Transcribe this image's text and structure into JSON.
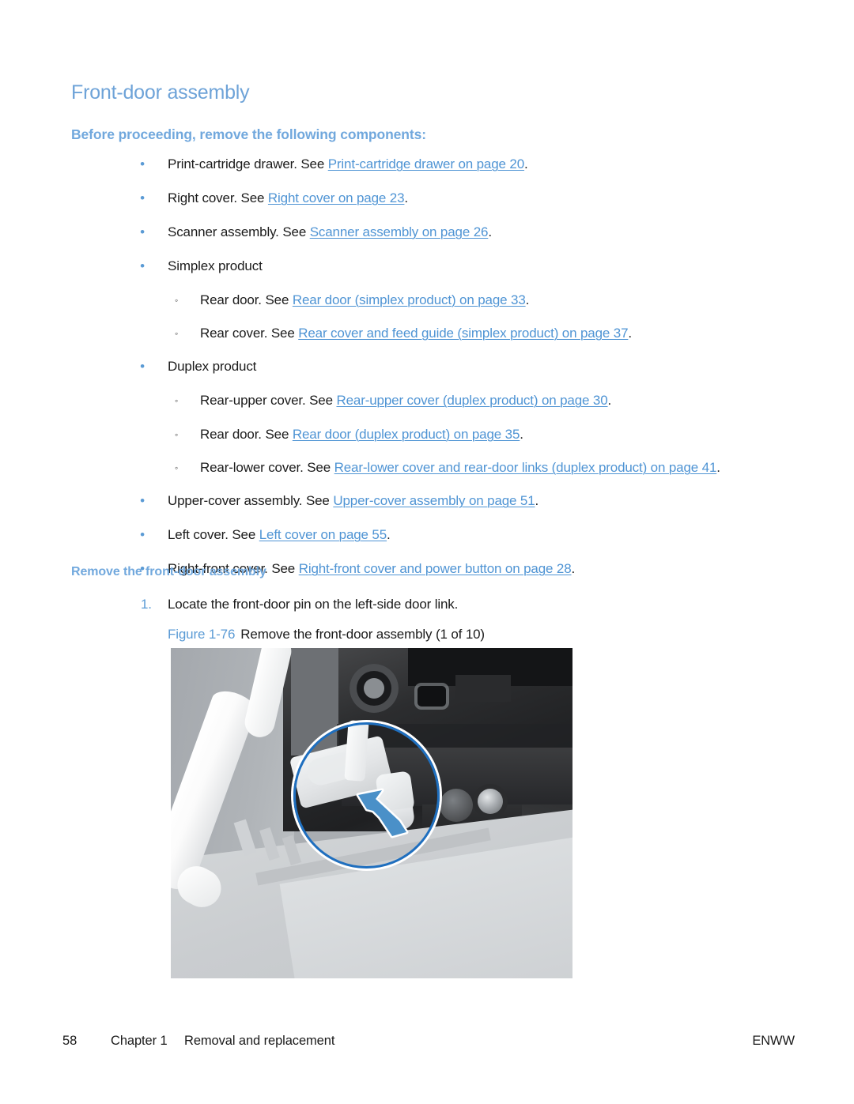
{
  "document": {
    "title": "Front-door assembly",
    "prereq_heading": "Before proceeding, remove the following components:",
    "procedure_heading": "Remove the front-door assembly"
  },
  "colors": {
    "heading_blue": "#6ea3d8",
    "subheading_blue": "#71a8dd",
    "link_blue": "#4f94d4",
    "bullet_blue": "#5b9bd5",
    "callout_blue": "#1f6fbf",
    "arrow_blue": "#4a90c8",
    "body_text": "#1b1b1b",
    "photo_background": "#a9adb1"
  },
  "prereq_items": [
    {
      "level": 1,
      "bullet": "•",
      "pre": "Print-cartridge drawer. See ",
      "link": "Print-cartridge drawer on page 20",
      "post": "."
    },
    {
      "level": 1,
      "bullet": "•",
      "pre": "Right cover. See ",
      "link": "Right cover on page 23",
      "post": "."
    },
    {
      "level": 1,
      "bullet": "•",
      "pre": "Scanner assembly. See ",
      "link": "Scanner assembly on page 26",
      "post": "."
    },
    {
      "level": 1,
      "bullet": "•",
      "pre": "Simplex product",
      "link": "",
      "post": ""
    },
    {
      "level": 2,
      "bullet": "◦",
      "pre": "Rear door. See ",
      "link": "Rear door (simplex product) on page 33",
      "post": "."
    },
    {
      "level": 2,
      "bullet": "◦",
      "pre": "Rear cover. See ",
      "link": "Rear cover and feed guide (simplex product) on page 37",
      "post": "."
    },
    {
      "level": 1,
      "bullet": "•",
      "pre": "Duplex product",
      "link": "",
      "post": ""
    },
    {
      "level": 2,
      "bullet": "◦",
      "pre": "Rear-upper cover. See ",
      "link": "Rear-upper cover (duplex product) on page 30",
      "post": "."
    },
    {
      "level": 2,
      "bullet": "◦",
      "pre": "Rear door. See ",
      "link": "Rear door (duplex product) on page 35",
      "post": "."
    },
    {
      "level": 2,
      "bullet": "◦",
      "pre": "Rear-lower cover. See ",
      "link": "Rear-lower cover and rear-door links (duplex product) on page 41",
      "post": "."
    },
    {
      "level": 1,
      "bullet": "•",
      "pre": "Upper-cover assembly. See ",
      "link": "Upper-cover assembly on page 51",
      "post": "."
    },
    {
      "level": 1,
      "bullet": "•",
      "pre": "Left cover. See ",
      "link": "Left cover on page 55",
      "post": "."
    },
    {
      "level": 1,
      "bullet": "•",
      "pre": "Right-front cover. See ",
      "link": "Right-front cover and power button on page 28",
      "post": "."
    }
  ],
  "step": {
    "number": "1.",
    "text": "Locate the front-door pin on the left-side door link."
  },
  "figure": {
    "number": "Figure 1-76",
    "caption": "Remove the front-door assembly (1 of 10)",
    "callout_circle": "circle-callout",
    "callout_arrow": "arrow-up-left-icon"
  },
  "footer": {
    "page_number": "58",
    "chapter": "Chapter 1",
    "chapter_title": "Removal and replacement",
    "brand": "ENWW"
  }
}
